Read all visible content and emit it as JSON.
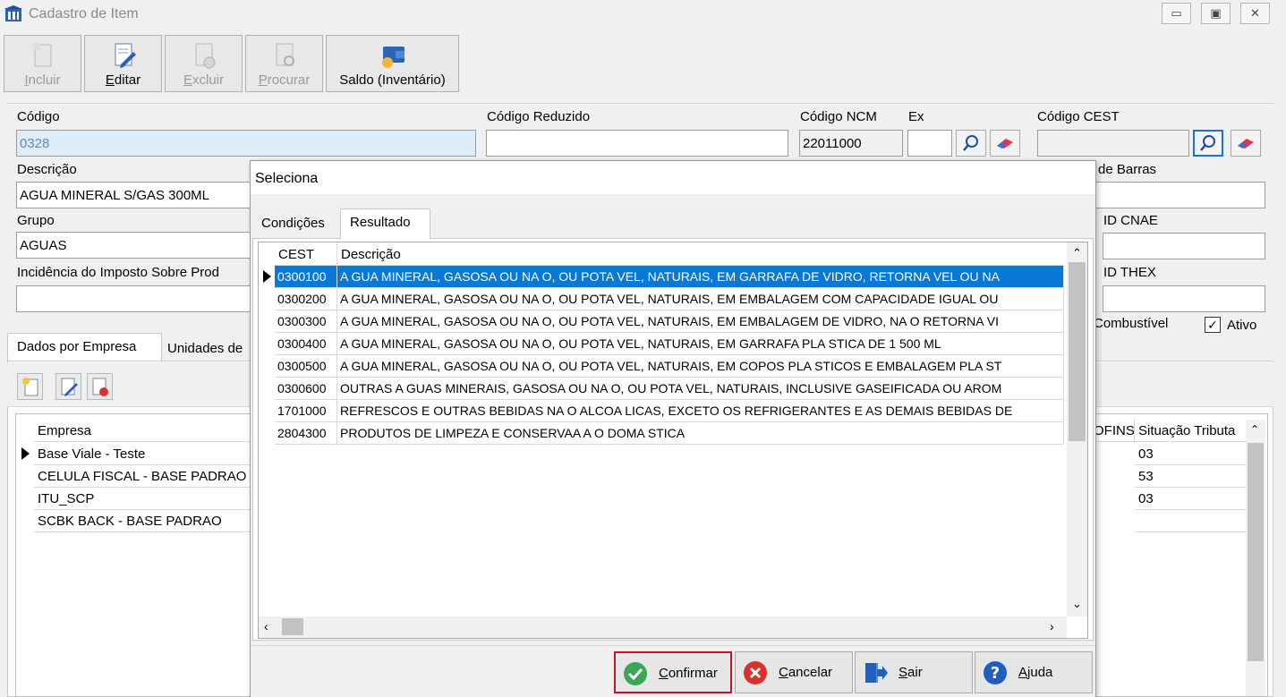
{
  "window": {
    "title": "Cadastro de Item"
  },
  "toolbar": {
    "incluir": "Incluir",
    "editar": "Editar",
    "excluir": "Excluir",
    "procurar": "Procurar",
    "saldo": "Saldo (Inventário)"
  },
  "form": {
    "codigo_label": "Código",
    "codigo_value": "0328",
    "codigo_reduzido_label": "Código Reduzido",
    "codigo_reduzido_value": "",
    "codigo_ncm_label": "Código NCM",
    "codigo_ncm_value": "22011000",
    "ex_label": "Ex",
    "ex_value": "",
    "codigo_cest_label": "Código CEST",
    "codigo_cest_value": "",
    "descricao_label": "Descrição",
    "descricao_value": "AGUA MINERAL S/GAS 300ML",
    "barras_label": "de Barras",
    "grupo_label": "Grupo",
    "grupo_value": "AGUAS",
    "id_cnae_label": "ID CNAE",
    "incidencia_label": "Incidência do Imposto Sobre Prod",
    "id_thex_label": "ID THEX",
    "combustivel_label": "Combustível",
    "ativo_label": "Ativo",
    "ativo_checked": true
  },
  "bg_tabs": {
    "tab1": "Dados por Empresa",
    "tab2": "Unidades de"
  },
  "empresa_grid": {
    "headers": {
      "empresa": "Empresa",
      "cofins": "OFINS",
      "situacao": "Situação Tributa"
    },
    "rows": [
      {
        "empresa": "Base Viale - Teste",
        "situacao": "03"
      },
      {
        "empresa": "CELULA FISCAL - BASE PADRAO",
        "situacao": "53"
      },
      {
        "empresa": "ITU_SCP",
        "situacao": "03"
      },
      {
        "empresa": "SCBK BACK - BASE PADRAO",
        "situacao": ""
      }
    ]
  },
  "dialog": {
    "title": "Seleciona",
    "tabs": {
      "condicoes": "Condições",
      "resultado": "Resultado"
    },
    "headers": {
      "cest": "CEST",
      "descricao": "Descrição"
    },
    "rows": [
      {
        "cest": "0300100",
        "descricao": "A GUA MINERAL, GASOSA OU NA O, OU POTA VEL, NATURAIS, EM GARRAFA DE VIDRO, RETORNA VEL OU NA"
      },
      {
        "cest": "0300200",
        "descricao": "A GUA MINERAL, GASOSA OU NA O, OU POTA VEL, NATURAIS, EM EMBALAGEM COM CAPACIDADE IGUAL OU"
      },
      {
        "cest": "0300300",
        "descricao": "A GUA MINERAL, GASOSA OU NA O, OU POTA VEL, NATURAIS, EM EMBALAGEM DE VIDRO, NA O RETORNA VI"
      },
      {
        "cest": "0300400",
        "descricao": "A GUA MINERAL, GASOSA OU NA O, OU POTA VEL, NATURAIS, EM GARRAFA PLA STICA DE 1 500 ML"
      },
      {
        "cest": "0300500",
        "descricao": "A GUA MINERAL, GASOSA OU NA O, OU POTA VEL, NATURAIS, EM COPOS PLA STICOS E EMBALAGEM PLA ST"
      },
      {
        "cest": "0300600",
        "descricao": "OUTRAS A GUAS MINERAIS, GASOSA OU NA O, OU POTA VEL, NATURAIS, INCLUSIVE GASEIFICADA OU AROM"
      },
      {
        "cest": "1701000",
        "descricao": "REFRESCOS E OUTRAS BEBIDAS NA O ALCOA LICAS, EXCETO OS REFRIGERANTES E AS DEMAIS BEBIDAS DE"
      },
      {
        "cest": "2804300",
        "descricao": "PRODUTOS DE LIMPEZA E CONSERVAA A O DOMA STICA"
      }
    ],
    "buttons": {
      "confirmar": "Confirmar",
      "cancelar": "Cancelar",
      "sair": "Sair",
      "ajuda": "Ajuda"
    }
  },
  "colors": {
    "selection": "#0a78d7",
    "highlight_border": "#c8102e",
    "confirm_green": "#3aa657",
    "cancel_red": "#d9342b",
    "help_blue": "#1f5fbf"
  }
}
